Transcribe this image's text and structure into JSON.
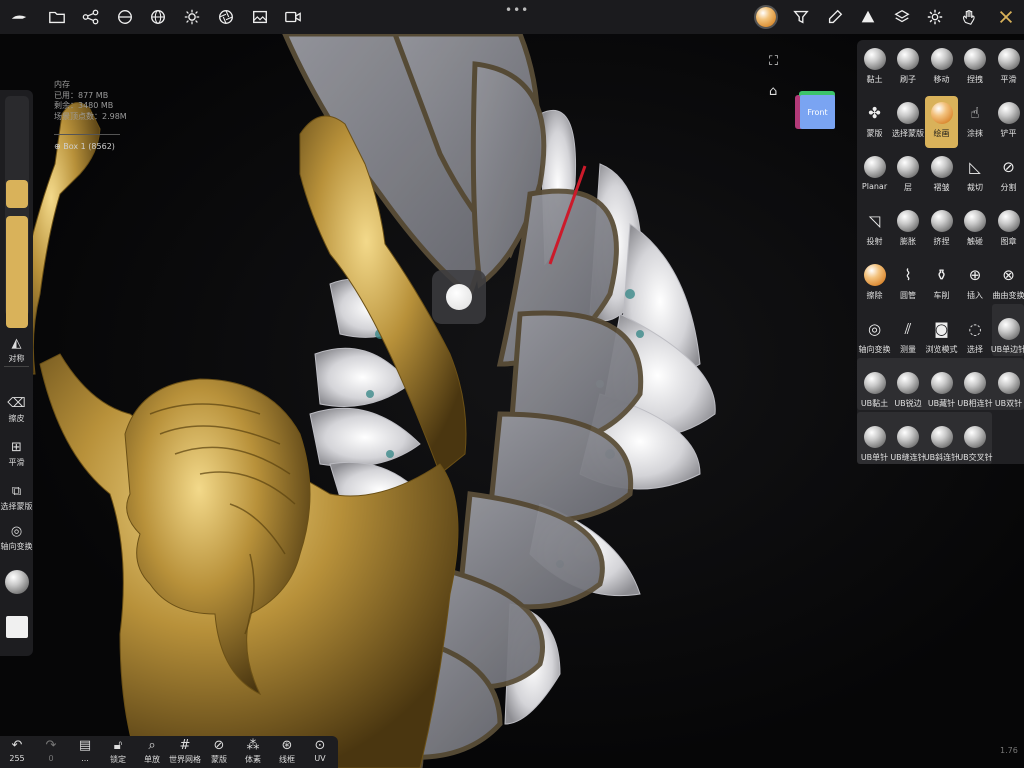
{
  "colors": {
    "accent": "#d9b25a",
    "topbar": "#1b1b1e",
    "panel": "#202023",
    "background": "#0b0b0d"
  },
  "topbar": {
    "left_icons": [
      "nomad-logo-icon",
      "folder-icon",
      "scene-graph-icon",
      "material-icon",
      "globe-icon",
      "sun-icon",
      "aperture-icon",
      "image-icon",
      "video-icon"
    ],
    "right_icons": [
      "material-ball-icon",
      "filter-icon",
      "dropper-icon",
      "triangle-icon",
      "layers-icon",
      "settings-icon",
      "gesture-icon",
      "tools-icon"
    ]
  },
  "stats": {
    "title": "内存",
    "used": "已用：877 MB",
    "free": "剩余：3480 MB",
    "vertices": "场景顶点数：2.98M",
    "object": "Box 1 (8562)"
  },
  "viewport": {
    "cube_label": "Front",
    "version": "1.76"
  },
  "left_panel": {
    "slider_icon": "slider-icon",
    "items": [
      {
        "label": "对称",
        "icon": "symmetry-icon"
      },
      {
        "label": "擦皮",
        "icon": "eraser-icon"
      },
      {
        "label": "平滑",
        "icon": "smooth-icon"
      },
      {
        "label": "选择蒙版",
        "icon": "select-mask-icon"
      },
      {
        "label": "轴向变换",
        "icon": "gizmo-icon"
      }
    ]
  },
  "bottom_bar": [
    {
      "label": "255",
      "icon": "undo-icon"
    },
    {
      "label": "0",
      "icon": "redo-icon"
    },
    {
      "label": "...",
      "icon": "stack-icon"
    },
    {
      "label": "锁定",
      "icon": "lock-icon"
    },
    {
      "label": "单放",
      "icon": "search-icon"
    },
    {
      "label": "世界网格",
      "icon": "grid-icon"
    },
    {
      "label": "蒙版",
      "icon": "eye-slash-icon"
    },
    {
      "label": "体素",
      "icon": "voxel-icon"
    },
    {
      "label": "线框",
      "icon": "wireframe-icon"
    },
    {
      "label": "UV",
      "icon": "uv-icon"
    }
  ],
  "tools": [
    {
      "label": "黏土",
      "icon": "sphere"
    },
    {
      "label": "刷子",
      "icon": "sphere"
    },
    {
      "label": "移动",
      "icon": "sphere"
    },
    {
      "label": "捏拽",
      "icon": "sphere"
    },
    {
      "label": "平滑",
      "icon": "sphere"
    },
    {
      "label": "蒙版",
      "icon": "puzzle-icon"
    },
    {
      "label": "选择蒙版",
      "icon": "sphere"
    },
    {
      "label": "绘画",
      "icon": "sphere-orange"
    },
    {
      "label": "涂抹",
      "icon": "smudge-icon"
    },
    {
      "label": "铲平",
      "icon": "sphere"
    },
    {
      "label": "Planar",
      "icon": "sphere"
    },
    {
      "label": "层",
      "icon": "sphere"
    },
    {
      "label": "褶皱",
      "icon": "sphere"
    },
    {
      "label": "裁切",
      "icon": "trim-icon"
    },
    {
      "label": "分割",
      "icon": "split-icon"
    },
    {
      "label": "投射",
      "icon": "project-icon"
    },
    {
      "label": "膨胀",
      "icon": "sphere"
    },
    {
      "label": "挤捏",
      "icon": "sphere"
    },
    {
      "label": "触碰",
      "icon": "sphere"
    },
    {
      "label": "图章",
      "icon": "sphere"
    },
    {
      "label": "擦除",
      "icon": "sphere-orange"
    },
    {
      "label": "圆管",
      "icon": "tube-icon"
    },
    {
      "label": "车削",
      "icon": "lathe-icon"
    },
    {
      "label": "插入",
      "icon": "insert-icon"
    },
    {
      "label": "曲由变换",
      "icon": "transform-icon"
    },
    {
      "label": "轴向变换",
      "icon": "gizmo-icon"
    },
    {
      "label": "测量",
      "icon": "ruler-icon"
    },
    {
      "label": "浏览模式",
      "icon": "camera-icon"
    },
    {
      "label": "选择",
      "icon": "lasso-icon"
    },
    {
      "label": "UB单边针",
      "icon": "sphere"
    },
    {
      "label": "UB黏土",
      "icon": "sphere"
    },
    {
      "label": "UB锐边",
      "icon": "sphere"
    },
    {
      "label": "UB藏针",
      "icon": "sphere"
    },
    {
      "label": "UB相连针",
      "icon": "sphere"
    },
    {
      "label": "UB双针",
      "icon": "sphere"
    },
    {
      "label": "UB单针",
      "icon": "sphere"
    },
    {
      "label": "UB缝连针",
      "icon": "sphere"
    },
    {
      "label": "UB斜连针",
      "icon": "sphere"
    },
    {
      "label": "UB交叉针",
      "icon": "sphere"
    }
  ]
}
